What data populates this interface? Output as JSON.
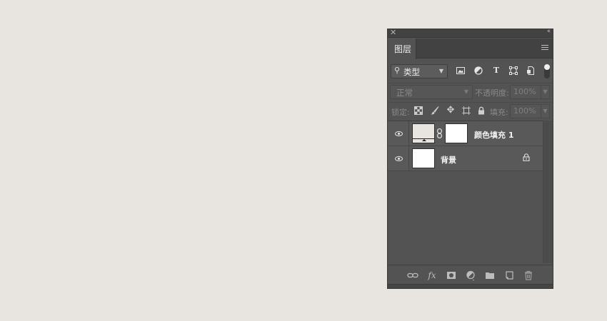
{
  "panel": {
    "close_glyph": "✕",
    "collapse_glyph": "‹‹",
    "tab_label": "图层"
  },
  "filter": {
    "kind_label": "类型",
    "icons": [
      "image-filter-icon",
      "adjustment-filter-icon",
      "type-filter-icon",
      "shape-filter-icon",
      "smart-object-filter-icon"
    ]
  },
  "blend": {
    "mode": "正常",
    "opacity_label": "不透明度:",
    "opacity_value": "100%"
  },
  "lock": {
    "label": "锁定:",
    "fill_label": "填充:",
    "fill_value": "100%"
  },
  "layers": [
    {
      "name": "颜色填充 1",
      "type": "color-fill",
      "visible": true,
      "fill_color": "#e8e4e0"
    },
    {
      "name": "背景",
      "type": "background",
      "visible": true,
      "locked": true,
      "fill_color": "#ffffff"
    }
  ],
  "footer_icons": [
    "link-layers-icon",
    "fx-icon",
    "add-mask-icon",
    "adjustment-layer-icon",
    "new-group-icon",
    "new-layer-icon",
    "delete-layer-icon"
  ],
  "colors": {
    "canvas_bg": "#e8e4e0",
    "panel_bg": "#535353",
    "layer_row": "#595959"
  }
}
